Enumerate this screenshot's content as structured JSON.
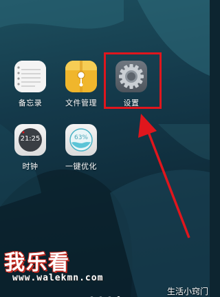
{
  "apps": [
    {
      "label": "备忘录",
      "icon": "notepad-icon"
    },
    {
      "label": "文件管理",
      "icon": "folder-icon"
    },
    {
      "label": "设置",
      "icon": "gear-icon"
    },
    {
      "label": "时钟",
      "icon": "clock-icon",
      "time": "21:25"
    },
    {
      "label": "一键优化",
      "icon": "optimize-icon",
      "percent": "63%"
    }
  ],
  "highlight_color": "#e0161d",
  "watermark": {
    "brand": "我乐看",
    "url": "www.walekmn.com"
  },
  "corner_text": "生活小窍门",
  "page_indicator": {
    "count": 4,
    "active": 4
  }
}
